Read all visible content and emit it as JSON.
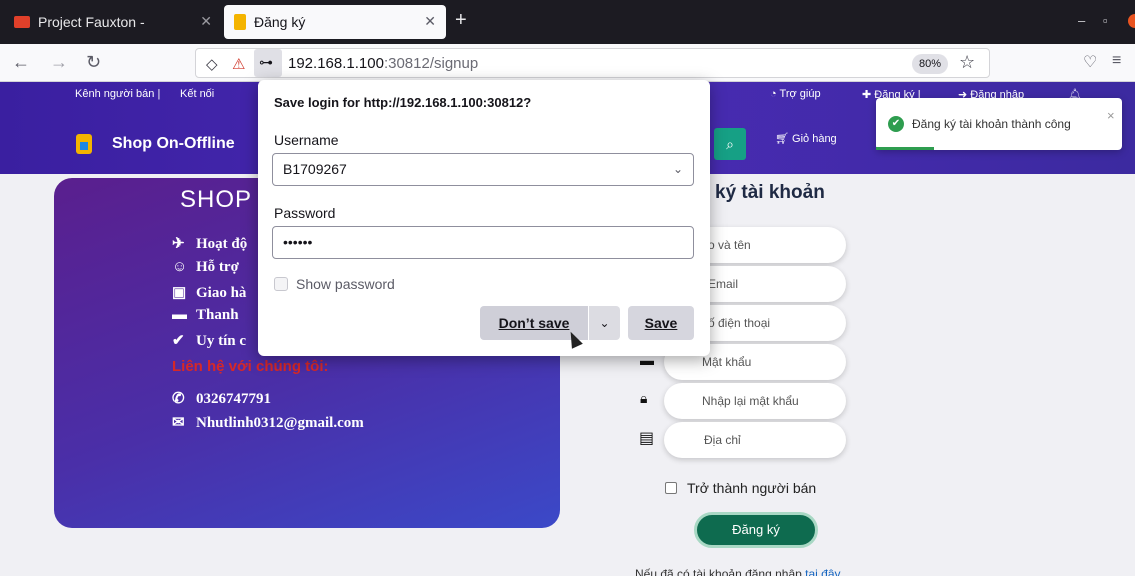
{
  "browser": {
    "tabs": [
      {
        "title": "Project Fauxton -",
        "favicon_color": "#e0402a"
      },
      {
        "title": "Đăng ký",
        "favicon_color": "#f4b400"
      }
    ],
    "new_tab_label": "+",
    "url_host": "192.168.1.100",
    "url_rest": ":30812/signup",
    "zoom": "80%"
  },
  "site": {
    "topnav": {
      "seller_channel": "Kênh người bán |",
      "connect": "Kết nối",
      "help": "Trợ giúp",
      "register": "Đăng ký |",
      "login": "Đăng nhập"
    },
    "brand": "Shop On-Offline",
    "cart": "Giỏ hàng",
    "promo": {
      "title": "SHOP",
      "items": [
        "Hoạt độ",
        "Hỗ trợ",
        "Giao hà",
        "Thanh",
        "Uy tín c"
      ],
      "contact_heading": "Liên hệ với chúng tôi:",
      "phone": "0326747791",
      "email": "Nhutlinh0312@gmail.com"
    },
    "form": {
      "title": "ký tài khoản",
      "fields": [
        "o và tên",
        "Email",
        "ố điện thoại",
        "Mật khẩu",
        "Nhập lại mật khẩu",
        "Địa chỉ"
      ],
      "seller_checkbox": "Trở thành người bán",
      "submit": "Đăng ký",
      "login_hint": "Nếu đã có tài khoản đăng nhập",
      "login_link": "tại đây"
    },
    "toast": {
      "message": "Đăng ký tài khoản thành công",
      "close": "×"
    }
  },
  "save_login_popup": {
    "title": "Save login for http://192.168.1.100:30812?",
    "username_label": "Username",
    "username_value": "B1709267",
    "password_label": "Password",
    "password_value": "••••••",
    "show_password": "Show password",
    "dont_save": "Don’t save",
    "save": "Save"
  }
}
